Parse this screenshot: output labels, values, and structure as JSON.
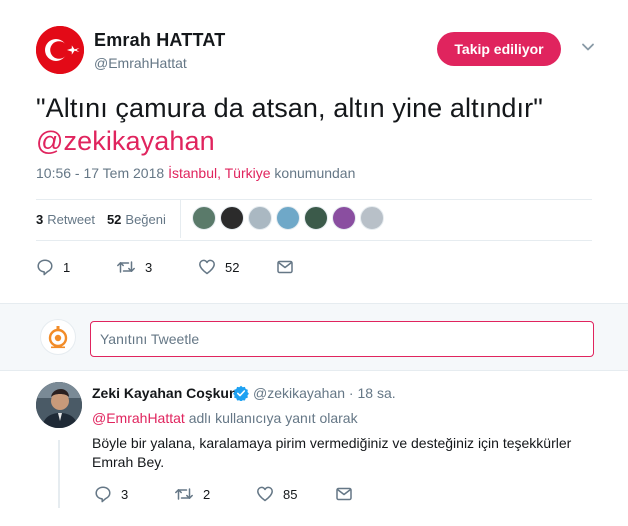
{
  "tweet": {
    "author_name": "Emrah HATTAT",
    "author_handle": "@EmrahHattat",
    "follow_label": "Takip ediliyor",
    "text": "\"Altını çamura da atsan, altın yine altındır\"",
    "mention": "@zekikayahan",
    "time": "10:56 - 17 Tem 2018",
    "location": "İstanbul, Türkiye",
    "location_suffix": "konumundan",
    "retweet_count": "3",
    "retweet_label": "Retweet",
    "like_count": "52",
    "like_label": "Beğeni",
    "actions": {
      "reply_count": "1",
      "retweet_count": "3",
      "like_count": "52"
    }
  },
  "reply_box": {
    "placeholder": "Yanıtını Tweetle"
  },
  "reply": {
    "author_name": "Zeki Kayahan Coşkun",
    "author_handle": "@zekikayahan · 18 sa.",
    "replying_mention": "@EmrahHattat",
    "replying_suffix": "adlı kullanıcıya yanıt olarak",
    "text_line1": "Böyle bir yalana, karalamaya pirim vermediğiniz ve desteğiniz için teşekkürler",
    "text_line2": "Emrah Bey.",
    "actions": {
      "reply_count": "3",
      "retweet_count": "2",
      "like_count": "85"
    }
  },
  "colors": {
    "accent": "#e0245e",
    "muted": "#657786",
    "text": "#14171a",
    "border": "#e6ecf0",
    "flag_red": "#e30a17"
  },
  "likers": [
    {
      "color": "#5a7a6a"
    },
    {
      "color": "#2b2b2b"
    },
    {
      "color": "#aab8c2"
    },
    {
      "color": "#6fa8c8"
    },
    {
      "color": "#3b5a4a"
    },
    {
      "color": "#8a4ea0"
    },
    {
      "color": "#b8c0c8"
    }
  ]
}
